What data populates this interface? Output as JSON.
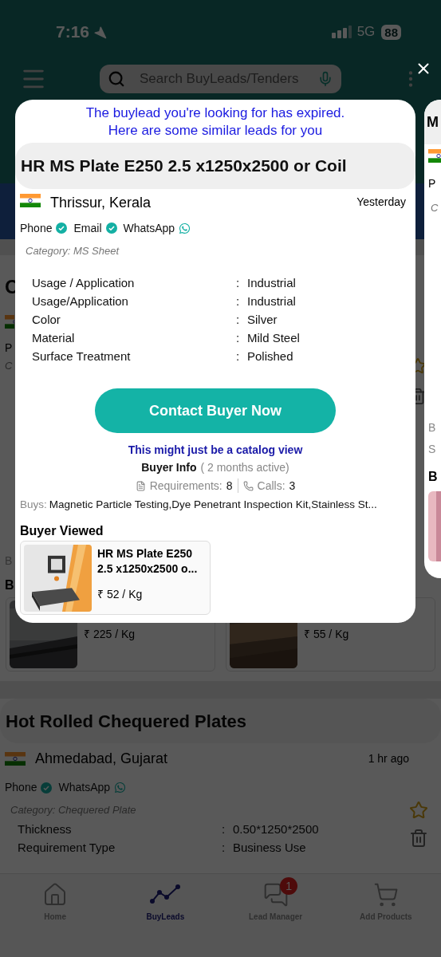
{
  "status_bar": {
    "time": "7:16",
    "network": "5G",
    "battery": "88"
  },
  "search": {
    "placeholder": "Search BuyLeads/Tenders"
  },
  "background": {
    "fragments": {
      "title": "C",
      "contact": "P",
      "category": "C",
      "line": "B",
      "section": "B"
    },
    "similar_products": [
      {
        "price": "₹ 225 / Kg",
        "kind": "picture"
      },
      {
        "price": "₹ 55 / Kg",
        "kind": "picture"
      }
    ],
    "lead": {
      "title": "Hot Rolled Chequered Plates",
      "location": "Ahmedabad, Gujarat",
      "time": "1 hr ago",
      "contacts": [
        {
          "label": "Phone",
          "kind": "verified"
        },
        {
          "label": "WhatsApp",
          "kind": "whatsapp"
        }
      ],
      "category": "Category: Chequered Plate",
      "specs": [
        {
          "label": "Thickness",
          "separator": ":",
          "value": "0.50*1250*2500"
        },
        {
          "label": "Requirement Type",
          "separator": ":",
          "value": "Business Use"
        }
      ]
    }
  },
  "next_card": {
    "title": "M",
    "contact": "P",
    "category": "C",
    "line_1": "B",
    "line_2": "S",
    "section": "B"
  },
  "modal": {
    "notice": [
      "The buylead you're looking for has expired.",
      "Here are some similar leads for you"
    ],
    "title": "HR MS Plate E250 2.5 x1250x2500 or Coil",
    "location": "Thrissur, Kerala",
    "time": "Yesterday",
    "contacts": [
      {
        "label": "Phone",
        "kind": "verified"
      },
      {
        "label": "Email",
        "kind": "verified"
      },
      {
        "label": "WhatsApp",
        "kind": "whatsapp"
      }
    ],
    "category": "Category: MS Sheet",
    "specs": [
      {
        "label": "Usage / Application",
        "separator": ":",
        "value": "Industrial"
      },
      {
        "label": "Usage/Application",
        "separator": ":",
        "value": "Industrial"
      },
      {
        "label": "Color",
        "separator": ":",
        "value": "Silver"
      },
      {
        "label": "Material",
        "separator": ":",
        "value": "Mild Steel"
      },
      {
        "label": "Surface Treatment",
        "separator": ":",
        "value": "Polished"
      }
    ],
    "button": "Contact Buyer Now",
    "catalog_note": "This might just be a catalog view",
    "buyer_info": {
      "label": "Buyer Info",
      "activity": "( 2 months active)"
    },
    "stats": [
      {
        "label": "Requirements:",
        "value": "8",
        "kind": "requirements"
      },
      {
        "label": "Calls:",
        "value": "3",
        "kind": "calls"
      }
    ],
    "buys": {
      "label": "Buys:",
      "value": "Magnetic Particle Testing,Dye Penetrant Inspection Kit,Stainless St..."
    },
    "viewed_heading": "Buyer Viewed",
    "viewed_product": {
      "title": "HR MS Plate E250 2.5 x1250x2500 o...",
      "price": "₹ 52 / Kg",
      "kind": "picture"
    }
  },
  "bottom_nav": [
    {
      "label": "Home",
      "selected": false,
      "kind": "home"
    },
    {
      "label": "BuyLeads",
      "selected": true,
      "kind": "leads"
    },
    {
      "label": "Lead Manager",
      "selected": false,
      "kind": "chat",
      "badge": "1"
    },
    {
      "label": "Add Products",
      "selected": false,
      "kind": "cart"
    }
  ]
}
